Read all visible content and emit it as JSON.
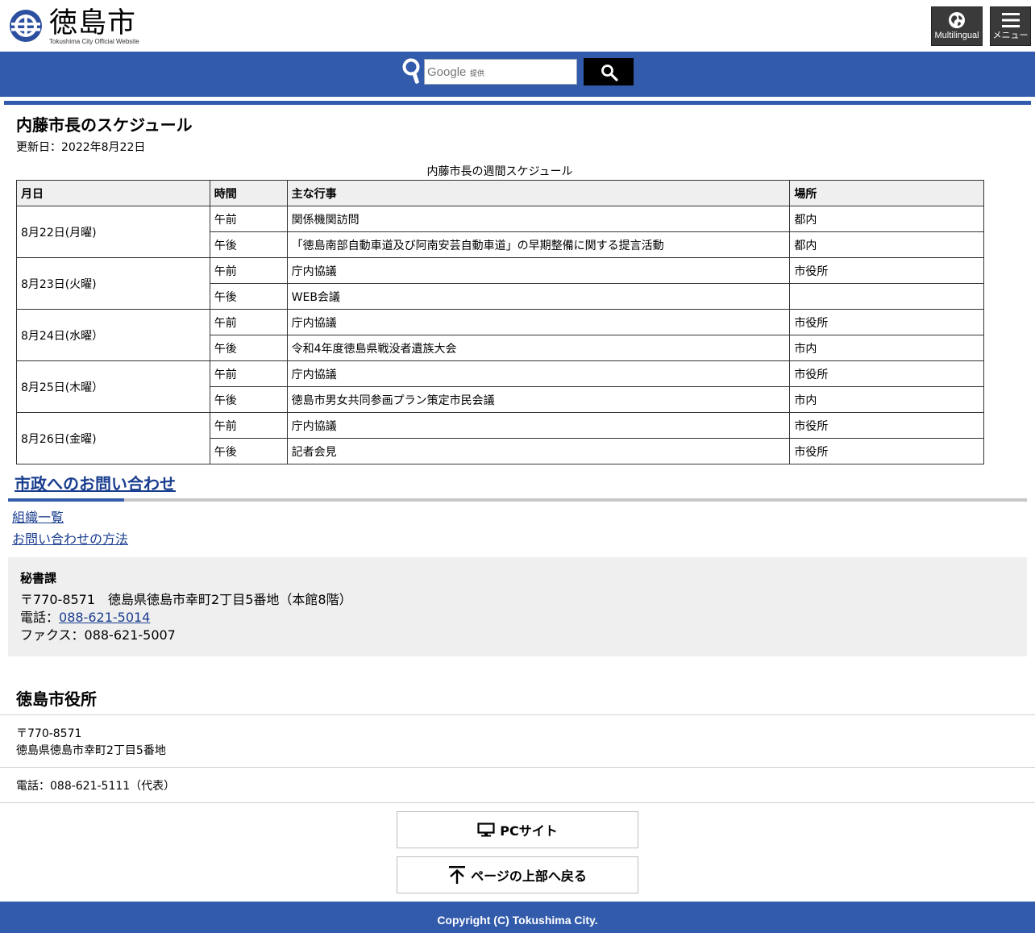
{
  "header": {
    "logo_text": "徳島市",
    "logo_sub": "Tokushima City Official Website",
    "multilingual_label": "Multilingual",
    "menu_label": "メニュー"
  },
  "search": {
    "google_label": "Google",
    "provided_label": "提供",
    "button_icon": "search-icon"
  },
  "page": {
    "title": "内藤市長のスケジュール",
    "updated": "更新日：2022年8月22日"
  },
  "schedule": {
    "caption": "内藤市長の週間スケジュール",
    "headers": [
      "月日",
      "時間",
      "主な行事",
      "場所"
    ],
    "days": [
      {
        "date": "8月22日(月曜)",
        "rows": [
          {
            "time": "午前",
            "event": "関係機関訪問",
            "place": "都内"
          },
          {
            "time": "午後",
            "event": "「徳島南部自動車道及び阿南安芸自動車道」の早期整備に関する提言活動",
            "place": "都内"
          }
        ]
      },
      {
        "date": "8月23日(火曜)",
        "rows": [
          {
            "time": "午前",
            "event": "庁内協議",
            "place": "市役所"
          },
          {
            "time": "午後",
            "event": "WEB会議",
            "place": ""
          }
        ]
      },
      {
        "date": "8月24日(水曜）",
        "rows": [
          {
            "time": "午前",
            "event": "庁内協議",
            "place": "市役所"
          },
          {
            "time": "午後",
            "event": "令和4年度徳島県戦没者遺族大会",
            "place": "市内"
          }
        ]
      },
      {
        "date": "8月25日(木曜）",
        "rows": [
          {
            "time": "午前",
            "event": "庁内協議",
            "place": "市役所"
          },
          {
            "time": "午後",
            "event": "徳島市男女共同参画プラン策定市民会議",
            "place": "市内"
          }
        ]
      },
      {
        "date": "8月26日(金曜)",
        "rows": [
          {
            "time": "午前",
            "event": "庁内協議",
            "place": "市役所"
          },
          {
            "time": "午後",
            "event": "記者会見",
            "place": "市役所"
          }
        ]
      }
    ]
  },
  "inquiry": {
    "heading": "市政へのお問い合わせ",
    "link_org": "組織一覧",
    "link_method": "お問い合わせの方法",
    "dept": "秘書課",
    "address": "〒770-8571　徳島県徳島市幸町2丁目5番地（本館8階）",
    "tel_label": "電話：",
    "tel": "088-621-5014",
    "fax": "ファクス：088-621-5007"
  },
  "office": {
    "title": "徳島市役所",
    "postal": "〒770-8571",
    "address": "徳島県徳島市幸町2丁目5番地",
    "tel": "電話：088-621-5111（代表）"
  },
  "footer": {
    "pc_site": "PCサイト",
    "back_to_top": "ページの上部へ戻る",
    "copyright": "Copyright (C) Tokushima City."
  },
  "colors": {
    "brand_blue": "#325bac",
    "link_blue": "#1a3e8f"
  }
}
